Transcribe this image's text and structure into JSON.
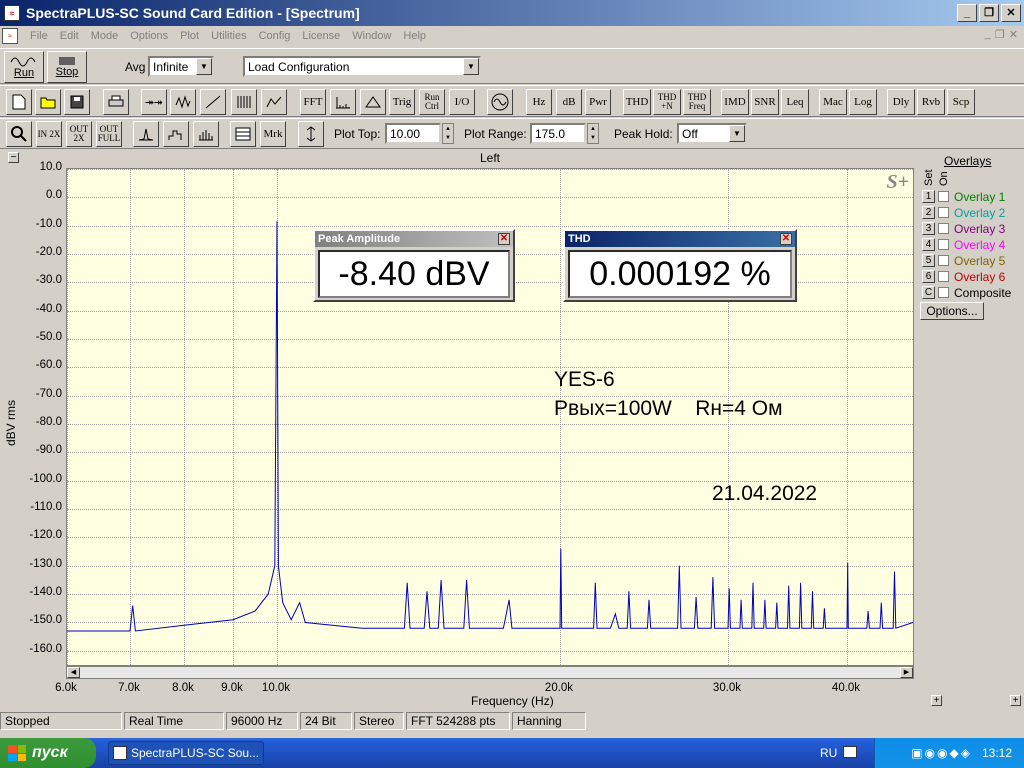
{
  "window": {
    "title": "SpectraPLUS-SC Sound Card Edition - [Spectrum]",
    "icon": "app-icon"
  },
  "menu": [
    "File",
    "Edit",
    "Mode",
    "Options",
    "Plot",
    "Utilities",
    "Config",
    "License",
    "Window",
    "Help"
  ],
  "toolbar1": {
    "run_label": "Run",
    "stop_label": "Stop",
    "avg_label": "Avg",
    "avg_value": "Infinite",
    "config_value": "Load Configuration"
  },
  "toolbar2": [
    "FFT",
    "Trig",
    "Run Ctrl",
    "I/O",
    "Hz",
    "dB",
    "Pwr",
    "THD",
    "THD +N",
    "THD Freq",
    "IMD",
    "SNR",
    "Leq",
    "Mac",
    "Log",
    "Dly",
    "Rvb",
    "Scp"
  ],
  "toolbar3": {
    "mrk": "Mrk",
    "plot_top_label": "Plot Top:",
    "plot_top_value": "10.00",
    "plot_range_label": "Plot Range:",
    "plot_range_value": "175.0",
    "peak_hold_label": "Peak Hold:",
    "peak_hold_value": "Off"
  },
  "plot": {
    "channel": "Left",
    "ylabel": "dBV rms",
    "xlabel": "Frequency (Hz)",
    "logo": "S+"
  },
  "popups": {
    "peak": {
      "title": "Peak Amplitude",
      "value": "-8.40 dBV"
    },
    "thd": {
      "title": "THD",
      "value": "0.000192 %"
    }
  },
  "annotations": {
    "line1": "YES-6",
    "line2": "Рвых=100W    Rн=4 Ом",
    "date": "21.04.2022"
  },
  "overlays": {
    "header": "Overlays",
    "set_label": "Set",
    "on_label": "On",
    "items": [
      {
        "num": "1",
        "label": "Overlay 1",
        "color": "#008000"
      },
      {
        "num": "2",
        "label": "Overlay 2",
        "color": "#00a0a0"
      },
      {
        "num": "3",
        "label": "Overlay 3",
        "color": "#800080"
      },
      {
        "num": "4",
        "label": "Overlay 4",
        "color": "#ff00ff"
      },
      {
        "num": "5",
        "label": "Overlay 5",
        "color": "#806000"
      },
      {
        "num": "6",
        "label": "Overlay 6",
        "color": "#c00000"
      },
      {
        "num": "C",
        "label": "Composite",
        "color": "#000000"
      }
    ],
    "options_label": "Options..."
  },
  "status": [
    "Stopped",
    "Real Time",
    "96000 Hz",
    "24 Bit",
    "Stereo",
    "FFT 524288 pts",
    "Hanning"
  ],
  "taskbar": {
    "start": "пуск",
    "task": "SpectraPLUS-SC Sou...",
    "lang": "RU",
    "clock": "13:12"
  },
  "chart_data": {
    "type": "line",
    "title": "Left",
    "xlabel": "Frequency (Hz)",
    "ylabel": "dBV rms",
    "xlim": [
      6000,
      45000
    ],
    "ylim": [
      -165,
      10
    ],
    "x_ticks": [
      {
        "v": 6000,
        "l": "6.0k"
      },
      {
        "v": 7000,
        "l": "7.0k"
      },
      {
        "v": 8000,
        "l": "8.0k"
      },
      {
        "v": 9000,
        "l": "9.0k"
      },
      {
        "v": 10000,
        "l": "10.0k"
      },
      {
        "v": 20000,
        "l": "20.0k"
      },
      {
        "v": 30000,
        "l": "30.0k"
      },
      {
        "v": 40000,
        "l": "40.0k"
      }
    ],
    "y_ticks": [
      10,
      0,
      -10,
      -20,
      -30,
      -40,
      -50,
      -60,
      -70,
      -80,
      -90,
      -100,
      -110,
      -120,
      -130,
      -140,
      -150,
      -160
    ],
    "grid": true,
    "series": [
      {
        "color": "#0000c0",
        "points": [
          [
            6000,
            -153
          ],
          [
            7000,
            -153
          ],
          [
            7050,
            -144
          ],
          [
            7100,
            -153
          ],
          [
            8000,
            -151
          ],
          [
            9000,
            -149
          ],
          [
            9500,
            -146
          ],
          [
            9800,
            -140
          ],
          [
            9950,
            -130
          ],
          [
            10000,
            -8.4
          ],
          [
            10050,
            -130
          ],
          [
            10200,
            -143
          ],
          [
            10500,
            -149
          ],
          [
            10800,
            -143
          ],
          [
            11000,
            -150
          ],
          [
            13000,
            -152
          ],
          [
            14000,
            -152
          ],
          [
            14500,
            -152
          ],
          [
            14600,
            -136
          ],
          [
            14700,
            -152
          ],
          [
            15200,
            -152
          ],
          [
            15300,
            -139
          ],
          [
            15400,
            -152
          ],
          [
            15700,
            -152
          ],
          [
            15800,
            -135
          ],
          [
            15900,
            -152
          ],
          [
            16600,
            -152
          ],
          [
            16700,
            -135
          ],
          [
            16800,
            -152
          ],
          [
            18000,
            -152
          ],
          [
            18200,
            -142
          ],
          [
            18300,
            -152
          ],
          [
            20000,
            -152
          ],
          [
            20050,
            -124
          ],
          [
            20100,
            -152
          ],
          [
            22000,
            -152
          ],
          [
            22100,
            -136
          ],
          [
            22200,
            -152
          ],
          [
            23000,
            -152
          ],
          [
            23300,
            -147
          ],
          [
            23500,
            -152
          ],
          [
            24000,
            -152
          ],
          [
            24100,
            -139
          ],
          [
            24200,
            -152
          ],
          [
            25200,
            -152
          ],
          [
            25300,
            -142
          ],
          [
            25400,
            -152
          ],
          [
            27000,
            -152
          ],
          [
            27100,
            -130
          ],
          [
            27200,
            -152
          ],
          [
            28000,
            -152
          ],
          [
            28100,
            -141
          ],
          [
            28200,
            -152
          ],
          [
            29000,
            -152
          ],
          [
            29100,
            -134
          ],
          [
            29200,
            -152
          ],
          [
            30000,
            -152
          ],
          [
            30100,
            -138
          ],
          [
            30200,
            -152
          ],
          [
            31000,
            -152
          ],
          [
            31100,
            -142
          ],
          [
            31200,
            -152
          ],
          [
            32000,
            -152
          ],
          [
            32100,
            -136
          ],
          [
            32200,
            -152
          ],
          [
            33000,
            -152
          ],
          [
            33100,
            -142
          ],
          [
            33200,
            -152
          ],
          [
            34000,
            -152
          ],
          [
            34100,
            -143
          ],
          [
            34200,
            -152
          ],
          [
            35000,
            -152
          ],
          [
            35100,
            -137
          ],
          [
            35200,
            -152
          ],
          [
            36000,
            -152
          ],
          [
            36100,
            -136
          ],
          [
            36200,
            -152
          ],
          [
            37000,
            -152
          ],
          [
            37100,
            -139
          ],
          [
            37200,
            -152
          ],
          [
            38000,
            -152
          ],
          [
            38100,
            -145
          ],
          [
            38200,
            -152
          ],
          [
            40000,
            -152
          ],
          [
            40050,
            -129
          ],
          [
            40100,
            -152
          ],
          [
            41500,
            -152
          ],
          [
            41600,
            -146
          ],
          [
            41700,
            -152
          ],
          [
            42500,
            -152
          ],
          [
            42600,
            -143
          ],
          [
            42700,
            -152
          ],
          [
            43500,
            -152
          ],
          [
            43600,
            -132
          ],
          [
            43700,
            -152
          ],
          [
            45000,
            -150
          ]
        ]
      }
    ]
  }
}
